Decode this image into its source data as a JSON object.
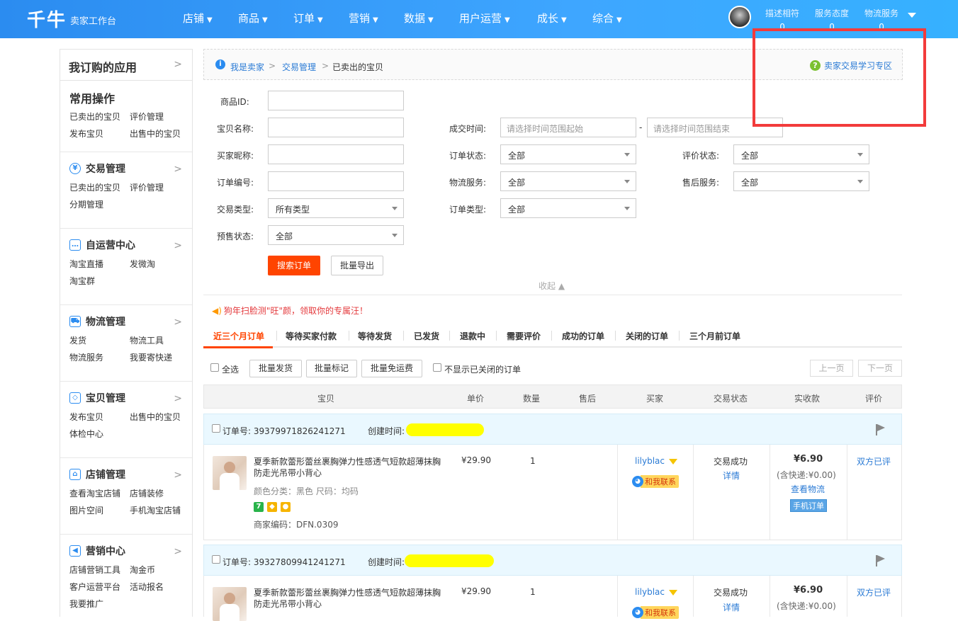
{
  "header": {
    "logo": "千牛",
    "logo_sub": "卖家工作台",
    "nav": [
      "店铺",
      "商品",
      "订单",
      "营销",
      "数据",
      "用户运营",
      "成长",
      "综合"
    ],
    "scores": [
      {
        "label": "描述相符",
        "value": "0"
      },
      {
        "label": "服务态度",
        "value": "0"
      },
      {
        "label": "物流服务",
        "value": "0"
      }
    ]
  },
  "sidebar": {
    "title": "我订购的应用",
    "common_title": "常用操作",
    "common_links": [
      "已卖出的宝贝",
      "评价管理",
      "发布宝贝",
      "出售中的宝贝"
    ],
    "sections": [
      {
        "icon": "yen-circle-icon",
        "title": "交易管理",
        "links": [
          "已卖出的宝贝",
          "评价管理",
          "分期管理"
        ]
      },
      {
        "icon": "chat-bubble-icon",
        "title": "自运营中心",
        "links": [
          "淘宝直播",
          "发微淘",
          "淘宝群"
        ]
      },
      {
        "icon": "truck-icon",
        "title": "物流管理",
        "links": [
          "发货",
          "物流工具",
          "物流服务",
          "我要寄快递"
        ]
      },
      {
        "icon": "bag-icon",
        "title": "宝贝管理",
        "links": [
          "发布宝贝",
          "出售中的宝贝",
          "体检中心"
        ]
      },
      {
        "icon": "store-icon",
        "title": "店铺管理",
        "links": [
          "查看淘宝店铺",
          "店铺装修",
          "图片空间",
          "手机淘宝店铺"
        ]
      },
      {
        "icon": "megaphone-icon",
        "title": "营销中心",
        "links": [
          "店铺营销工具",
          "淘金币",
          "客户运营平台",
          "活动报名",
          "我要推广"
        ]
      }
    ]
  },
  "breadcrumb": {
    "items": [
      "我是卖家",
      "交易管理",
      "已卖出的宝贝"
    ],
    "help": "卖家交易学习专区"
  },
  "filters": {
    "product_id": "商品ID:",
    "item_name": "宝贝名称:",
    "buyer_nick": "买家昵称:",
    "order_no": "订单编号:",
    "trade_type": "交易类型:",
    "trade_type_value": "所有类型",
    "presale": "预售状态:",
    "presale_value": "全部",
    "deal_time": "成交时间:",
    "time_start_placeholder": "请选择时间范围起始",
    "time_dash": "-",
    "time_end_placeholder": "请选择时间范围结束",
    "order_status": "订单状态:",
    "order_status_value": "全部",
    "logistics": "物流服务:",
    "logistics_value": "全部",
    "order_type": "订单类型:",
    "order_type_value": "全部",
    "review_status": "评价状态:",
    "review_status_value": "全部",
    "after_sale": "售后服务:",
    "after_sale_value": "全部",
    "search_btn": "搜索订单",
    "export_btn": "批量导出",
    "collapse": "收起 ▲"
  },
  "promo": "狗年扫脸测\"旺\"颜，领取你的专属汪！",
  "tabs": [
    "近三个月订单",
    "等待买家付款",
    "等待发货",
    "已发货",
    "退款中",
    "需要评价",
    "成功的订单",
    "关闭的订单",
    "三个月前订单"
  ],
  "toolbar": {
    "select_all": "全选",
    "batch_ship": "批量发货",
    "batch_mark": "批量标记",
    "batch_free_ship": "批量免运费",
    "hide_closed": "不显示已关闭的订单",
    "prev": "上一页",
    "next": "下一页"
  },
  "table_headers": [
    "宝贝",
    "单价",
    "数量",
    "售后",
    "买家",
    "交易状态",
    "实收款",
    "评价"
  ],
  "orders": [
    {
      "order_label": "订单号: 39379971826241271",
      "created_label": "创建时间:",
      "title": "夏季新款蕾形蕾丝裹胸弹力性感透气短款超薄抹胸防走光吊带小背心",
      "attrs": "颜色分类：黑色   尺码：均码",
      "merchant_code": "商家编码：DFN.0309",
      "price": "¥29.90",
      "qty": "1",
      "buyer": "lilyblac",
      "contact": "和我联系",
      "status": "交易成功",
      "detail": "详情",
      "paid": "¥6.90",
      "shipping": "(含快递:¥0.00)",
      "logistics": "查看物流",
      "mobile": "手机订单",
      "review": "双方已评"
    },
    {
      "order_label": "订单号: 39327809941241271",
      "created_label": "创建时间:",
      "title": "夏季新款蕾形蕾丝裹胸弹力性感透气短款超薄抹胸防走光吊带小背心",
      "price": "¥29.90",
      "qty": "1",
      "buyer": "lilyblac",
      "contact": "和我联系",
      "status": "交易成功",
      "detail": "详情",
      "paid": "¥6.90",
      "shipping": "(含快递:¥0.00)",
      "review": "双方已评"
    }
  ],
  "colors": {
    "brand": "#2b8cf0",
    "accent": "#ff4400",
    "highlight": "#ffff00",
    "annotation": "#f23b3b"
  }
}
